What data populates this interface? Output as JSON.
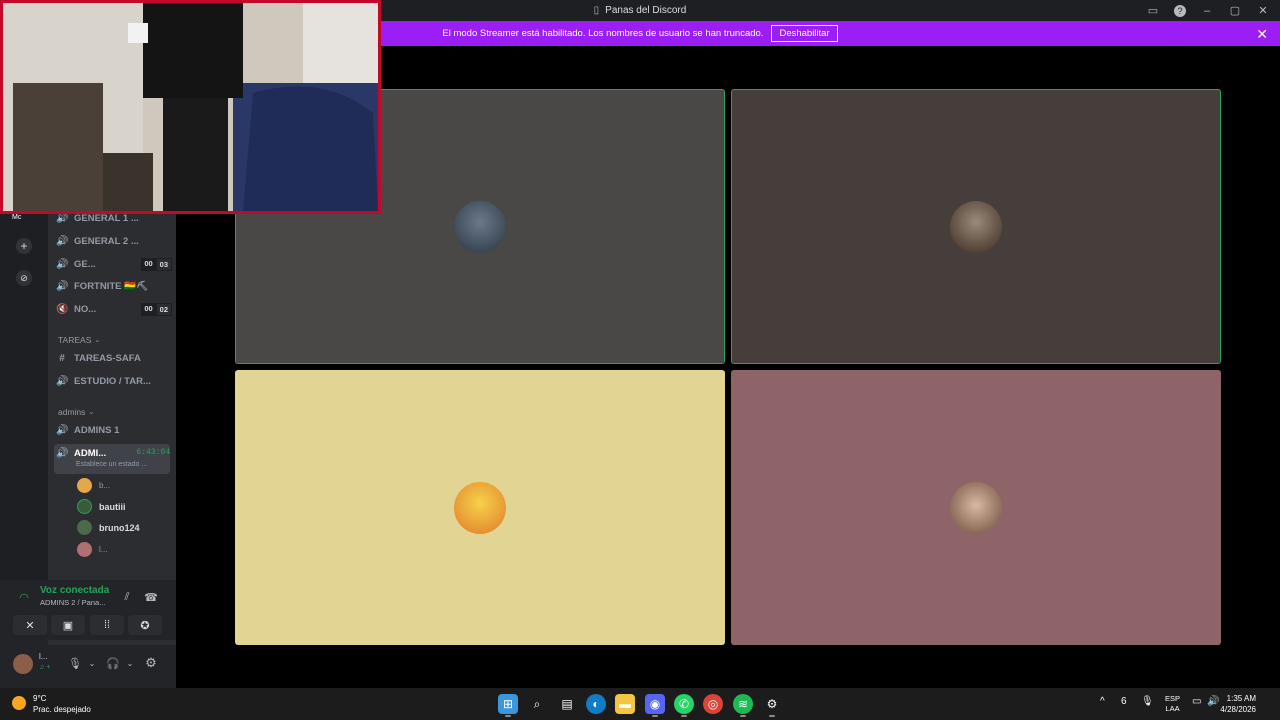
{
  "window": {
    "title": "Panas del Discord",
    "title_icon": "discord-frame-icon",
    "controls": [
      "inbox-icon",
      "help-icon",
      "minimize-icon",
      "maximize-icon",
      "close-icon"
    ]
  },
  "banner": {
    "message": "El modo Streamer está habilitado. Los nombres de usuario se han truncado.",
    "button_label": "Deshabilitar",
    "close_glyph": "✕",
    "color": "#9b1ff5"
  },
  "guild_rail": {
    "server_abbrev": "Mc",
    "add_glyph": "+",
    "discover_glyph": "⊘"
  },
  "channels": [
    {
      "icon": "🔊",
      "name": "GENERAL 1 ..."
    },
    {
      "icon": "🔊",
      "name": "GENERAL 2 ..."
    },
    {
      "icon": "🔊",
      "name": "GE...",
      "count_a": "00",
      "count_b": "03"
    },
    {
      "icon": "🔊",
      "name": "FORTNITE 🇧🇴⛏"
    },
    {
      "icon": "🔇",
      "name": "NO...",
      "count_a": "00",
      "count_b": "02"
    }
  ],
  "categories": {
    "tareas": "TAREAS",
    "admins": "admins"
  },
  "tareas_channels": [
    {
      "icon": "#",
      "name": "TAREAS-SAFA"
    },
    {
      "icon": "🔊",
      "name": "ESTUDIO / TAR..."
    }
  ],
  "admins_channels": [
    {
      "icon": "🔊",
      "name": "ADMINS 1"
    }
  ],
  "active_channel": {
    "icon": "🔊",
    "name": "ADMI...",
    "timer": "6:43:04",
    "status": "Establece un estado ..."
  },
  "members": [
    {
      "name": "b...",
      "color": "#e6a64b"
    },
    {
      "name": "bautiii",
      "color": "#3a5a3a"
    },
    {
      "name": "bruno124",
      "color": "#4a6a4a"
    },
    {
      "name": "l...",
      "color": "#b07070"
    }
  ],
  "voice": {
    "connected_label": "Voz conectada",
    "channel_sub": "ADMINS 2 / Pana...",
    "signal_icon": "signal-icon",
    "noise_icon": "noise-suppression-icon",
    "disconnect_glyph": "☎",
    "buttons": [
      "✕",
      "▣",
      "⁞⁞",
      "✪"
    ]
  },
  "user": {
    "name": "l...",
    "sub": "♫ +"
  },
  "tiles": [
    {
      "bg": "#4a4747",
      "speaking": true,
      "avatar": "#3a4a5a"
    },
    {
      "bg": "#463e3a",
      "speaking": true,
      "avatar": "#5a4a3a"
    },
    {
      "bg": "#e2d594",
      "speaking": false,
      "avatar": "#e59a3a"
    },
    {
      "bg": "#8f6468",
      "speaking": false,
      "avatar": "#c6a48a"
    }
  ],
  "taskbar": {
    "weather_temp": "9°C",
    "weather_desc": "Prac. despejado",
    "lang_1": "ESP",
    "lang_2": "LAA",
    "time": "1:35 AM",
    "date": "4/28/2026",
    "tray_glyphs": [
      "^",
      "6",
      "🎙"
    ],
    "apps": [
      {
        "name": "start",
        "glyph": "⊞",
        "color": "#3a96dd"
      },
      {
        "name": "search",
        "glyph": "⌕",
        "color": "#1c1c1c"
      },
      {
        "name": "task-view",
        "glyph": "▤",
        "color": "#1c1c1c"
      },
      {
        "name": "edge",
        "glyph": "◐",
        "color": "#0f7cc4"
      },
      {
        "name": "explorer",
        "glyph": "▬",
        "color": "#f4c542"
      },
      {
        "name": "discord",
        "glyph": "◉",
        "color": "#5865f2"
      },
      {
        "name": "whatsapp",
        "glyph": "✆",
        "color": "#25d366"
      },
      {
        "name": "chrome",
        "glyph": "◎",
        "color": "#db4437"
      },
      {
        "name": "spotify",
        "glyph": "≋",
        "color": "#1db954"
      },
      {
        "name": "gear-app",
        "glyph": "⚙",
        "color": "#1c1c1c"
      }
    ]
  }
}
